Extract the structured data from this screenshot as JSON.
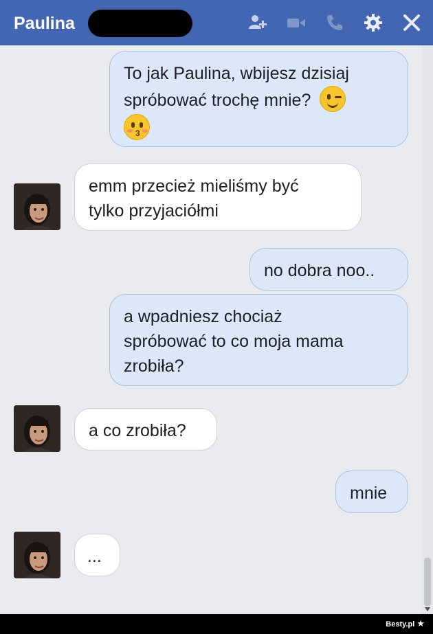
{
  "header": {
    "contact_name": "Paulina",
    "icons": [
      "add-friend-icon",
      "video-call-icon",
      "phone-icon",
      "gear-icon",
      "close-icon"
    ],
    "background_color": "#4266b2"
  },
  "messages": [
    {
      "sender": "me",
      "lines": [
        "To jak Paulina, wbijesz dzisiaj",
        "spróbować trochę mnie?"
      ],
      "emojis": [
        "winking-face",
        "kissing-face"
      ]
    },
    {
      "sender": "them",
      "lines": [
        "emm przecież mieliśmy być",
        "tylko przyjaciółmi"
      ]
    },
    {
      "sender": "me",
      "lines": [
        "no dobra noo.."
      ]
    },
    {
      "sender": "me",
      "lines": [
        "a wpadniesz chociaż",
        "spróbować to co moja mama",
        "zrobiła?"
      ]
    },
    {
      "sender": "them",
      "lines": [
        "a co zrobiła?"
      ]
    },
    {
      "sender": "me",
      "lines": [
        "mnie"
      ]
    },
    {
      "sender": "them",
      "lines": [
        "..."
      ]
    }
  ],
  "colors": {
    "my_bubble": "#dce8f9",
    "their_bubble": "#ffffff",
    "chat_background": "#e9ebee"
  },
  "watermark": "Besty.pl"
}
